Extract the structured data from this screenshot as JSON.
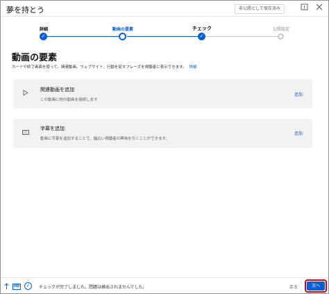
{
  "window": {
    "title": "夢を持とう",
    "draft_status": "非公開として保存済み"
  },
  "stepper": {
    "steps": [
      {
        "label": "詳細",
        "state": "done"
      },
      {
        "label": "動画の要素",
        "state": "current"
      },
      {
        "label": "チェック",
        "state": "done"
      },
      {
        "label": "公開設定",
        "state": "future"
      }
    ]
  },
  "main": {
    "title": "動画の要素",
    "description": "カードや終了画面を使って、関連動画、ウェブサイト、行動を促すフレーズを視聴者に表示できます。",
    "details_link": "詳細",
    "cards": [
      {
        "icon": "play-icon",
        "title": "関連動画を追加",
        "subtitle": "この動画に他の動画を接続します",
        "action": "追加"
      },
      {
        "icon": "subtitles-icon",
        "icon_text": "CC",
        "title": "字幕を追加",
        "subtitle": "動画に字幕を追加することで、幅広い視聴者の興味を引くことができます。",
        "action": "追加"
      }
    ]
  },
  "footer": {
    "hd_label": "HD",
    "status_text": "チェックが完了しました。問題は検出されませんでした。",
    "back_label": "戻る",
    "next_label": "次へ"
  },
  "colors": {
    "accent": "#065fd4",
    "highlight_outline": "#d0021b",
    "card_bg": "#f2f2f2"
  }
}
